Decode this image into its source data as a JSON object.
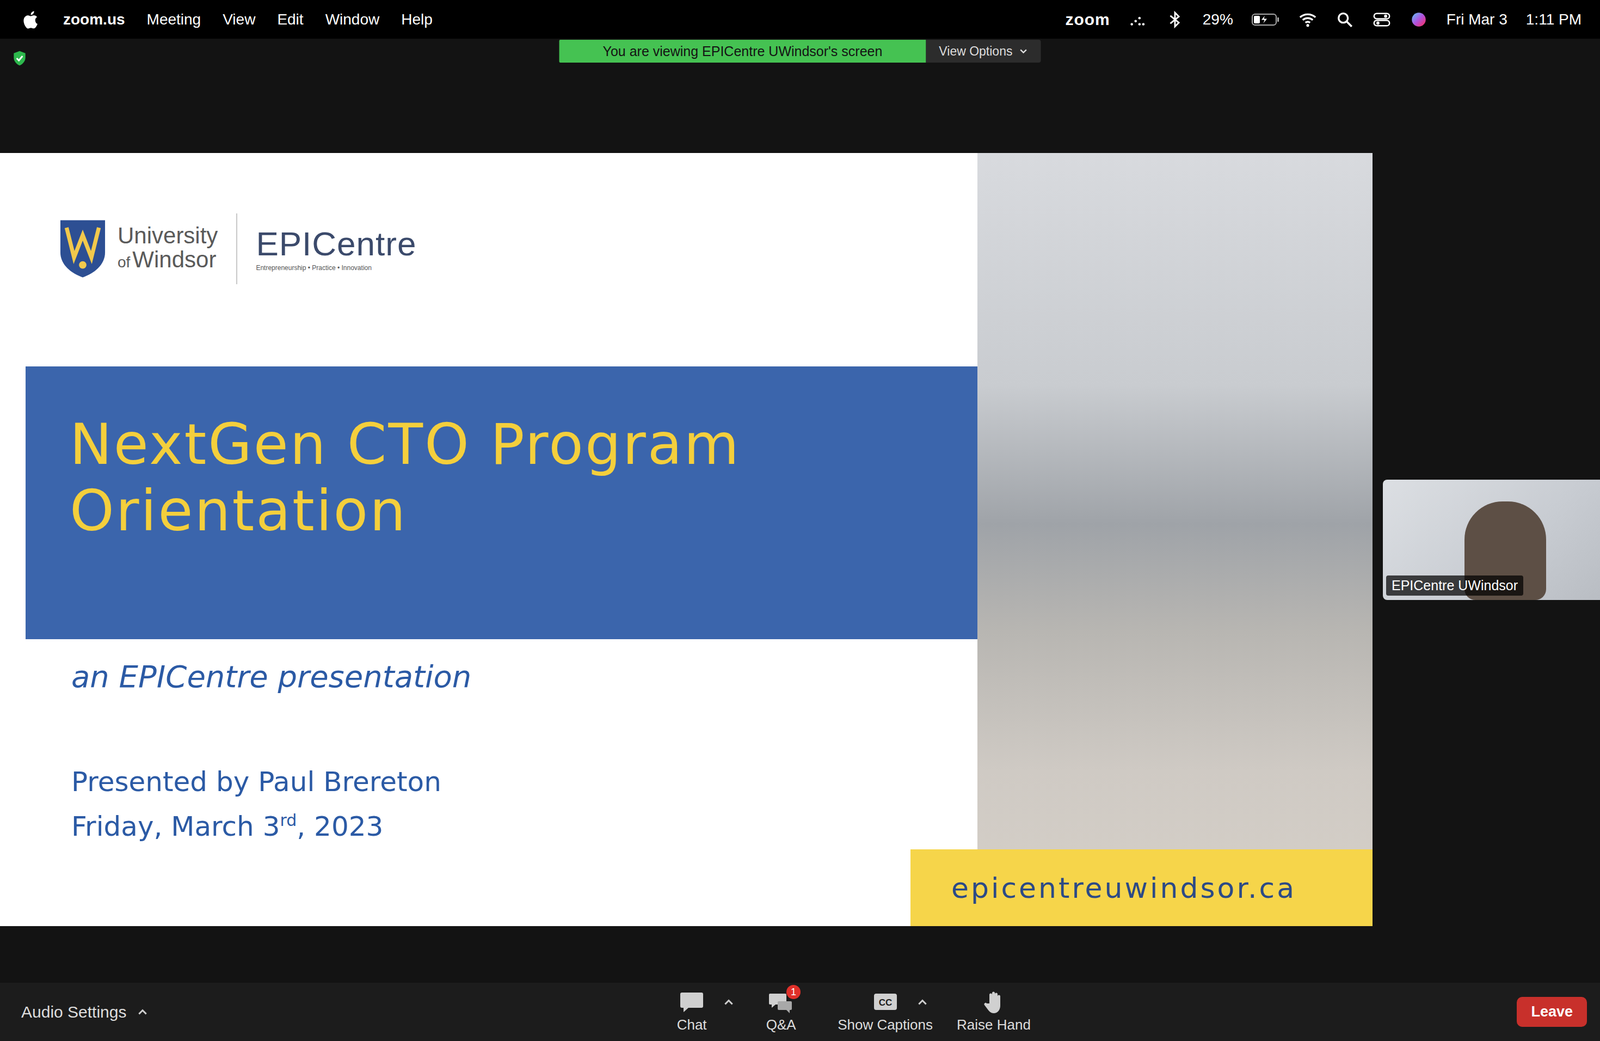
{
  "menubar": {
    "app": "zoom.us",
    "menus": [
      "Meeting",
      "View",
      "Edit",
      "Window",
      "Help"
    ],
    "zoom_label": "zoom",
    "battery": {
      "reading": "29%",
      "level": 0.29,
      "charging": true
    },
    "date": "Fri Mar 3",
    "time": "1:11 PM"
  },
  "banner": {
    "text": "You are viewing EPICentre UWindsor's screen",
    "options_label": "View Options"
  },
  "slide": {
    "university": {
      "line1": "University",
      "of": "of",
      "line2": "Windsor"
    },
    "brand": {
      "name": "EPICentre",
      "tagline": "Entrepreneurship • Practice • Innovation"
    },
    "title_lines": [
      "NextGen CTO Program",
      "Orientation"
    ],
    "subtitle": "an EPICentre presentation",
    "presenter": "Presented by Paul Brereton",
    "date": {
      "main": "Friday, March 3",
      "sup": "rd",
      "rest": ", 2023"
    },
    "url": "epicentreuwindsor.ca"
  },
  "participant": {
    "name": "EPICentre UWindsor"
  },
  "toolbar": {
    "audio": "Audio Settings",
    "buttons": [
      {
        "label": "Chat",
        "kind": "chat",
        "menu": true,
        "badge": null,
        "icon_text": null
      },
      {
        "label": "Q&A",
        "kind": "qa",
        "menu": false,
        "badge": "1",
        "icon_text": null
      },
      {
        "label": "Show Captions",
        "kind": "captions",
        "menu": true,
        "badge": null,
        "icon_text": "CC"
      },
      {
        "label": "Raise Hand",
        "kind": "hand",
        "menu": false,
        "badge": null,
        "icon_text": null
      }
    ],
    "leave": "Leave"
  }
}
